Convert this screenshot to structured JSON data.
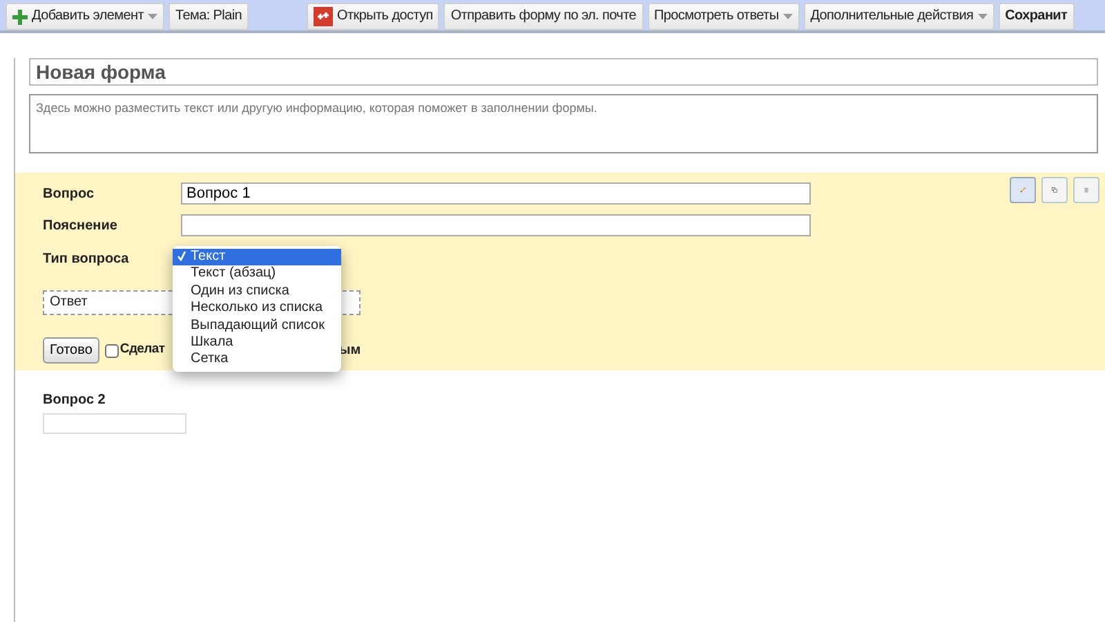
{
  "toolbar": {
    "left": [
      {
        "label": "Добавить элемент",
        "kind": "add"
      },
      {
        "label": "Тема:  Plain",
        "kind": "plain"
      }
    ],
    "right": [
      {
        "label": "Открыть доступ",
        "kind": "share"
      },
      {
        "label": "Отправить форму по эл. почте",
        "kind": "plain"
      },
      {
        "label": "Просмотреть ответы",
        "kind": "menu"
      },
      {
        "label": "Дополнительные действия",
        "kind": "menu"
      },
      {
        "label": "Сохранит",
        "kind": "bold"
      }
    ]
  },
  "form": {
    "title": "Новая форма",
    "description_placeholder": "Здесь можно разместить текст или другую информацию, которая поможет в заполнении формы."
  },
  "question_editor": {
    "question_label": "Вопрос",
    "question_value": "Вопрос 1",
    "help_label": "Пояснение",
    "type_label": "Тип вопроса",
    "type_menu": [
      {
        "label": "Текст",
        "selected": true
      },
      {
        "label": "Текст (абзац)",
        "selected": false
      },
      {
        "label": "Один из списка",
        "selected": false
      },
      {
        "label": "Несколько из списка",
        "selected": false
      },
      {
        "label": "Выпадающий список",
        "selected": false
      },
      {
        "label": "Шкала",
        "selected": false
      },
      {
        "label": "Сетка",
        "selected": false
      }
    ],
    "answer_placeholder": "Ответ",
    "done_button": "Готово",
    "required": {
      "checked": false,
      "label_start": "Сделат",
      "label_end": "ым"
    }
  },
  "questions": [
    {
      "title": "Вопрос 2"
    }
  ]
}
